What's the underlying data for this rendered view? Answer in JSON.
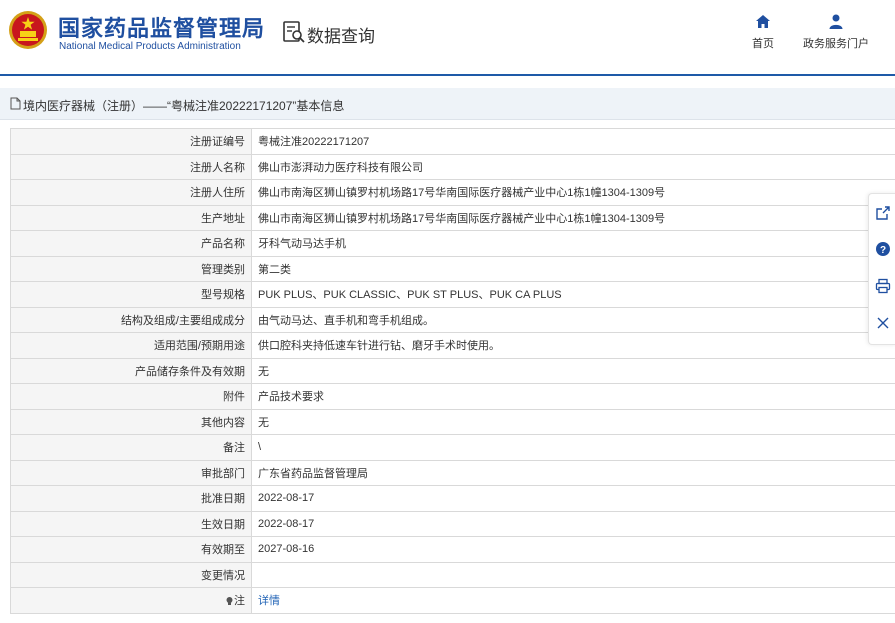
{
  "header": {
    "brand_cn": "国家药品监督管理局",
    "brand_en": "National Medical Products Administration",
    "query_title": "数据查询",
    "nav": [
      {
        "label": "首页",
        "icon": "home-icon"
      },
      {
        "label": "政务服务门户",
        "icon": "user-icon"
      }
    ]
  },
  "breadcrumb": {
    "text": "境内医疗器械（注册）——“粤械注准20222171207”基本信息",
    "icon": "document-icon"
  },
  "rows": [
    {
      "label": "注册证编号",
      "value": "粤械注准20222171207"
    },
    {
      "label": "注册人名称",
      "value": "佛山市澎湃动力医疗科技有限公司"
    },
    {
      "label": "注册人住所",
      "value": "佛山市南海区狮山镇罗村机场路17号华南国际医疗器械产业中心1栋1幢1304-1309号"
    },
    {
      "label": "生产地址",
      "value": "佛山市南海区狮山镇罗村机场路17号华南国际医疗器械产业中心1栋1幢1304-1309号"
    },
    {
      "label": "产品名称",
      "value": "牙科气动马达手机"
    },
    {
      "label": "管理类别",
      "value": "第二类"
    },
    {
      "label": "型号规格",
      "value": "PUK PLUS、PUK CLASSIC、PUK ST PLUS、PUK CA PLUS"
    },
    {
      "label": "结构及组成/主要组成成分",
      "value": "由气动马达、直手机和弯手机组成。"
    },
    {
      "label": "适用范围/预期用途",
      "value": "供口腔科夹持低速车针进行钻、磨牙手术时使用。"
    },
    {
      "label": "产品储存条件及有效期",
      "value": "无"
    },
    {
      "label": "附件",
      "value": "产品技术要求"
    },
    {
      "label": "其他内容",
      "value": "无"
    },
    {
      "label": "备注",
      "value": "\\"
    },
    {
      "label": "审批部门",
      "value": "广东省药品监督管理局"
    },
    {
      "label": "批准日期",
      "value": "2022-08-17"
    },
    {
      "label": "生效日期",
      "value": "2022-08-17"
    },
    {
      "label": "有效期至",
      "value": "2027-08-16"
    },
    {
      "label": "变更情况",
      "value": ""
    }
  ],
  "note_row": {
    "label": "注",
    "link": "详情",
    "icon": "lightbulb-icon"
  },
  "side_toolbar": [
    {
      "name": "share",
      "icon": "share-icon"
    },
    {
      "name": "help",
      "icon": "help-icon"
    },
    {
      "name": "print",
      "icon": "print-icon"
    },
    {
      "name": "close",
      "icon": "close-icon"
    }
  ],
  "colors": {
    "brand_blue": "#1f4fa0",
    "header_rule": "#1e5aa8",
    "link": "#1f62b5",
    "breadcrumb_bg": "#eef3f8",
    "label_bg": "#f5f5f5"
  }
}
